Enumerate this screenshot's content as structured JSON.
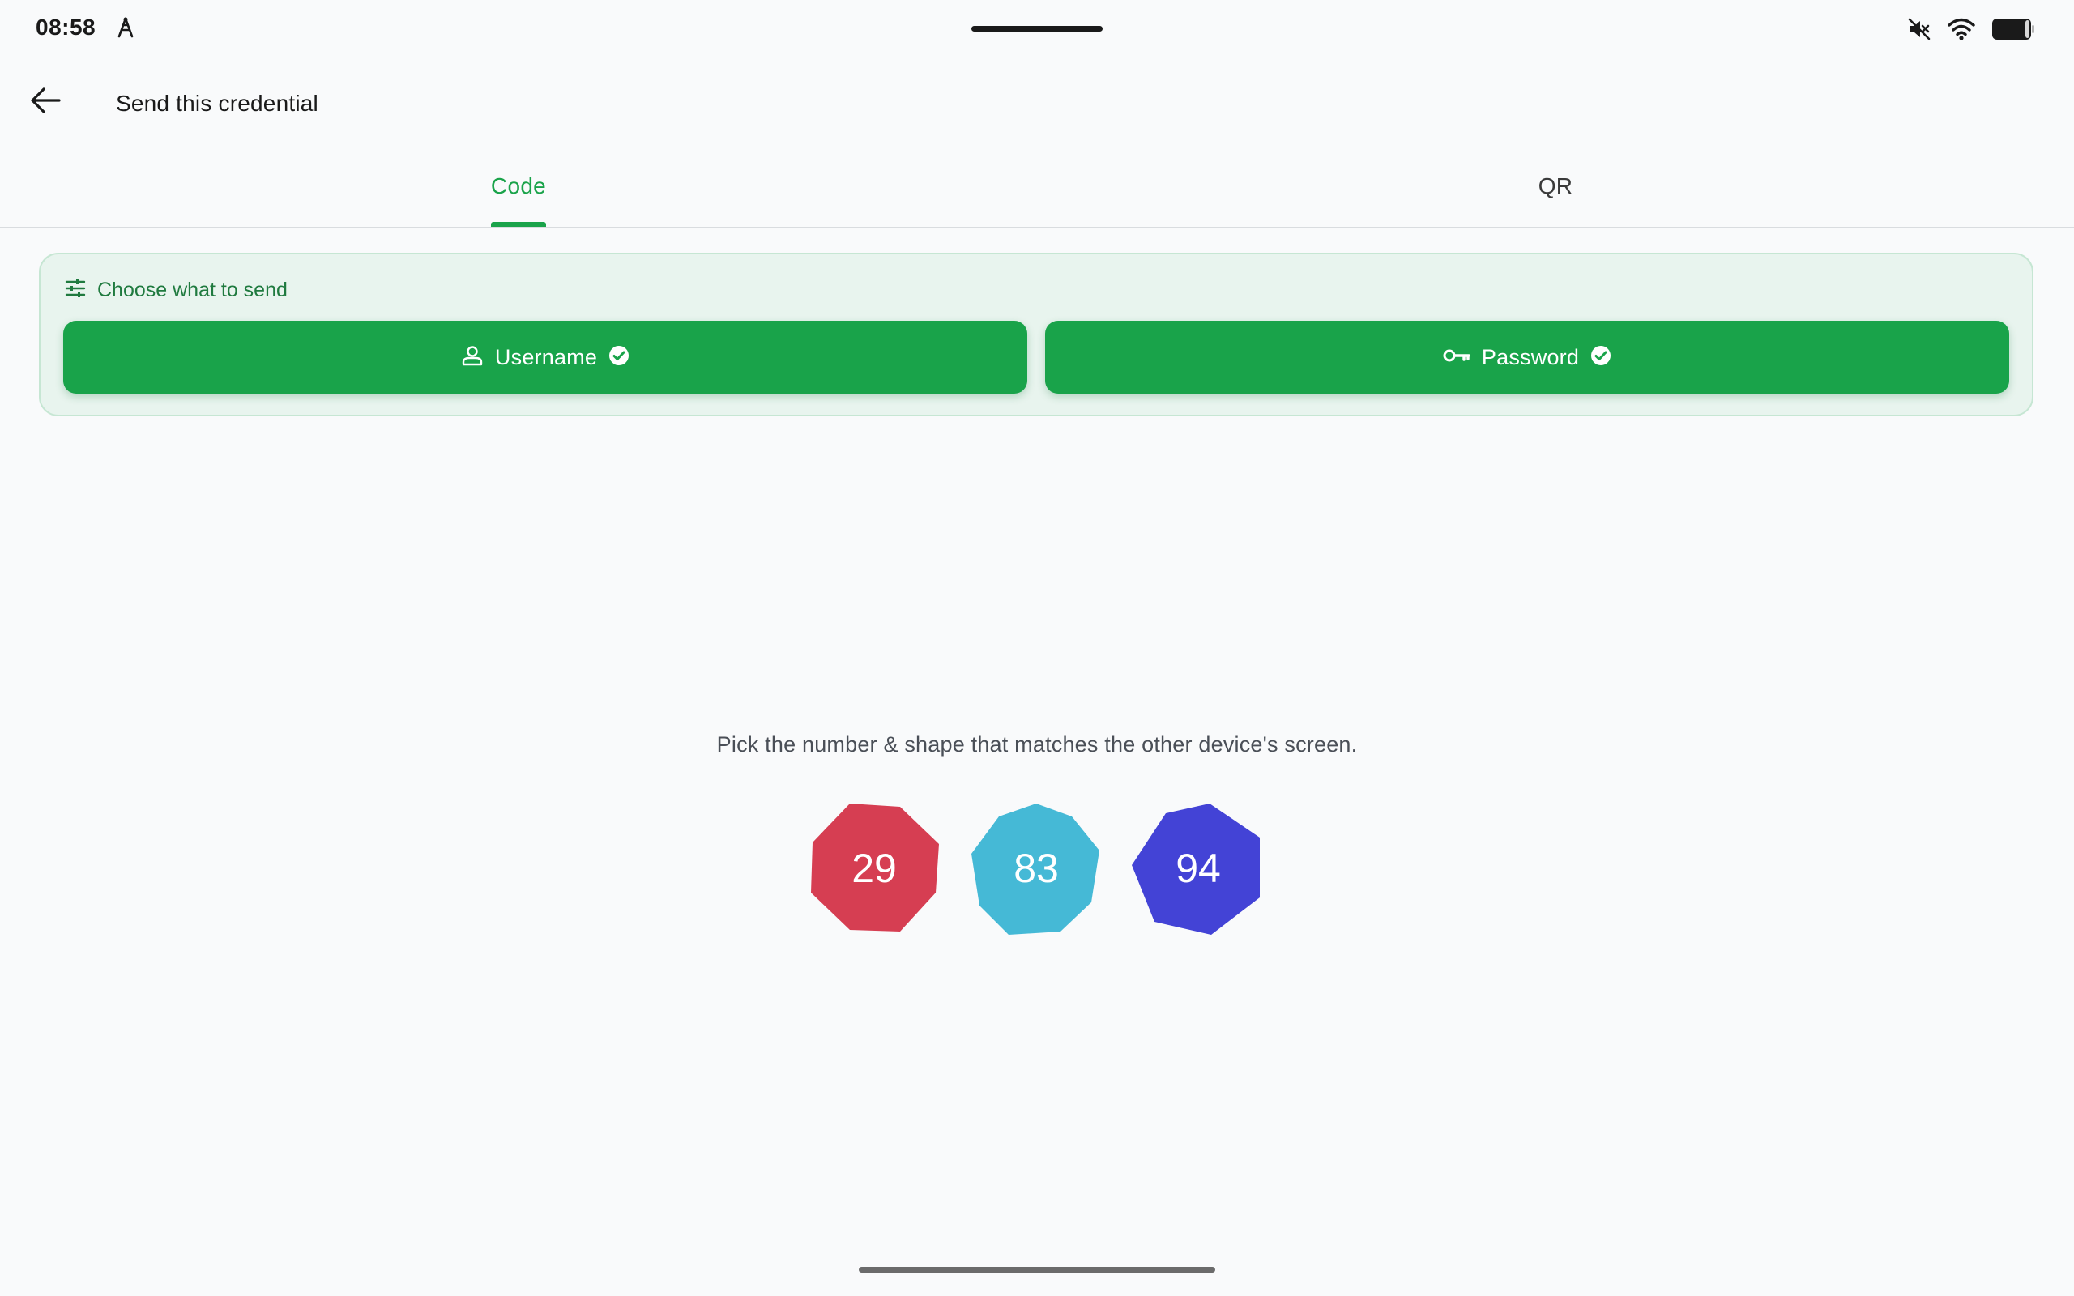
{
  "status_bar": {
    "time": "08:58",
    "icons": [
      "signal-tower-icon",
      "mute-icon",
      "wifi-icon",
      "battery-icon"
    ]
  },
  "app_bar": {
    "title": "Send this credential",
    "back_icon": "arrow-back-icon"
  },
  "tabs": [
    {
      "label": "Code",
      "selected": true
    },
    {
      "label": "QR",
      "selected": false
    }
  ],
  "choose": {
    "title": "Choose what to send",
    "icon": "tune-icon",
    "options": [
      {
        "label": "Username",
        "icon": "person-icon",
        "checked": true
      },
      {
        "label": "Password",
        "icon": "key-icon",
        "checked": true
      }
    ]
  },
  "instruction": "Pick the number & shape that matches the other device's screen.",
  "shapes": [
    {
      "number": "29",
      "color": "#d63e52",
      "shape": "octagon"
    },
    {
      "number": "83",
      "color": "#45b9d6",
      "shape": "nonagon"
    },
    {
      "number": "94",
      "color": "#4343d6",
      "shape": "heptagon"
    }
  ],
  "colors": {
    "accent": "#1aa34a",
    "card_bg": "#e8f4ee",
    "background": "#f9fafb"
  }
}
